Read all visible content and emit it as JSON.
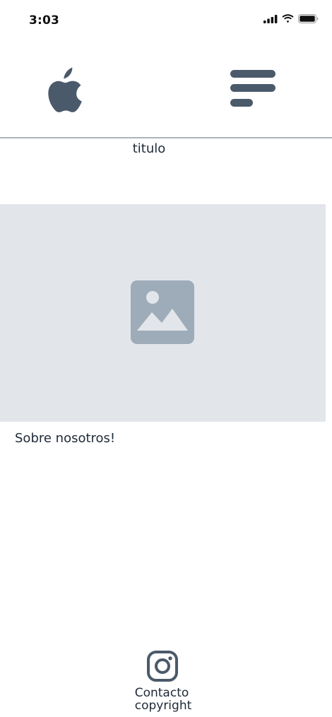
{
  "status_bar": {
    "time": "3:03",
    "icons": [
      "cellular-signal-icon",
      "wifi-icon",
      "battery-icon"
    ]
  },
  "header": {
    "logo_icon": "apple-logo-icon",
    "menu_icon": "menu-icon"
  },
  "main": {
    "title": "titulo",
    "hero_image_icon": "image-placeholder-icon",
    "about_text": "Sobre nosotros!"
  },
  "footer": {
    "social_icon": "instagram-icon",
    "contact_label": "Contacto",
    "copyright_label": "copyright"
  },
  "colors": {
    "icon": "#4b5a6a",
    "placeholder_bg": "#e2e6ea",
    "placeholder_icon": "#9eabb9",
    "divider": "#adb3bb",
    "text": "#1f2937"
  }
}
